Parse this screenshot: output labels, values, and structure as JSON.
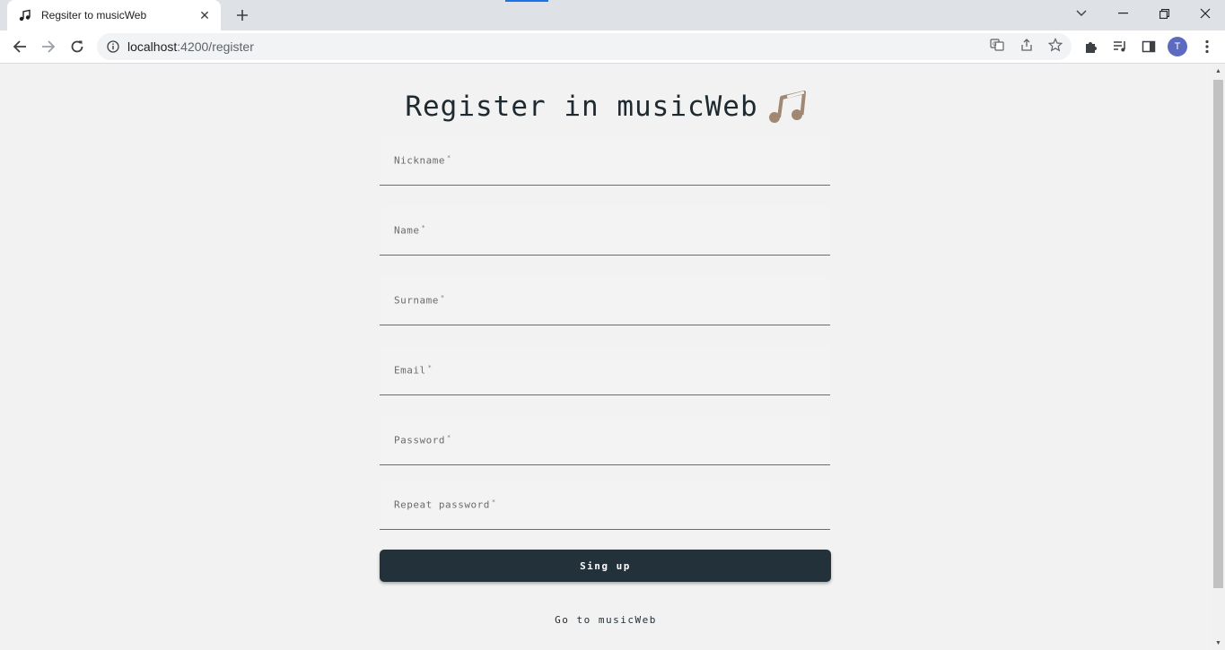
{
  "browser": {
    "tab_title": "Regsiter to musicWeb",
    "url_host": "localhost",
    "url_port_path": ":4200/register",
    "profile_initial": "T"
  },
  "page": {
    "heading": "Register in musicWeb",
    "fields": [
      {
        "label": "Nickname",
        "required": "*"
      },
      {
        "label": "Name",
        "required": "*"
      },
      {
        "label": "Surname",
        "required": "*"
      },
      {
        "label": "Email",
        "required": "*"
      },
      {
        "label": "Password",
        "required": "*"
      },
      {
        "label": "Repeat password",
        "required": "*"
      }
    ],
    "signup_label": "Sing up",
    "goto_label": "Go to musicWeb"
  },
  "colors": {
    "accent_dark": "#22313a",
    "notes": "#a18872"
  },
  "icons": [
    "music-notes-icon",
    "close-icon",
    "plus-icon",
    "back-icon",
    "forward-icon",
    "reload-icon",
    "info-icon",
    "translate-icon",
    "share-icon",
    "star-icon",
    "puzzle-icon",
    "media-icon",
    "sidepanel-icon",
    "menu-icon"
  ]
}
